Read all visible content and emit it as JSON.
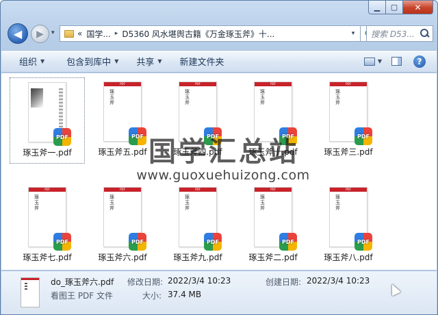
{
  "window": {
    "controls": {
      "minimize": "▁",
      "maximize": "▢",
      "close": "✕"
    }
  },
  "nav": {
    "back_icon": "◀",
    "forward_icon": "▶",
    "history_icon": "▾",
    "address": {
      "prefix": "«",
      "crumbs": [
        "国学...",
        "D5360 风水堪舆古籍《万金琢玉斧》十..."
      ],
      "separator": "▸",
      "dropdown": "▾"
    },
    "refresh_icon": "⟳",
    "search": {
      "placeholder": "搜索 D53..."
    }
  },
  "toolbar": {
    "organize": "组织",
    "include_library": "包含到库中",
    "share": "共享",
    "new_folder": "新建文件夹",
    "dropdown_arrow": "▼",
    "view_icon": "view-icon",
    "preview_pane_icon": "pane-icon",
    "help": "?"
  },
  "files": [
    {
      "name": "琢玉斧一.pdf",
      "thumb_title": "",
      "scan": true
    },
    {
      "name": "琢玉斧五.pdf",
      "thumb_title": "琢玉斧",
      "scan": false
    },
    {
      "name": "琢玉斧四.pdf",
      "thumb_title": "琢玉斧",
      "scan": false
    },
    {
      "name": "琢玉斧十.pdf",
      "thumb_title": "琢玉斧",
      "scan": false
    },
    {
      "name": "琢玉斧三.pdf",
      "thumb_title": "琢玉斧",
      "scan": false
    },
    {
      "name": "琢玉斧七.pdf",
      "thumb_title": "琢玉斧",
      "scan": false
    },
    {
      "name": "琢玉斧六.pdf",
      "thumb_title": "琢玉斧",
      "scan": false
    },
    {
      "name": "琢玉斧九.pdf",
      "thumb_title": "琢玉斧",
      "scan": false
    },
    {
      "name": "琢玉斧二.pdf",
      "thumb_title": "琢玉斧",
      "scan": false
    },
    {
      "name": "琢玉斧八.pdf",
      "thumb_title": "琢玉斧",
      "scan": false
    }
  ],
  "thumb_bar_text": "PDF",
  "badge_text": "PDF",
  "watermark": {
    "main": "国学汇总站",
    "url": "www.guoxuehuizong.com"
  },
  "details": {
    "filename": "do_琢玉斧六.pdf",
    "filetype": "看图王 PDF 文件",
    "modified_label": "修改日期:",
    "modified_value": "2022/3/4 10:23",
    "created_label": "创建日期:",
    "created_value": "2022/3/4 10:23",
    "size_label": "大小:",
    "size_value": "37.4 MB"
  },
  "colors": {
    "pdf_red": "#c8222a",
    "toolbar_text": "#1e395b",
    "close_button": "#c7432a"
  }
}
